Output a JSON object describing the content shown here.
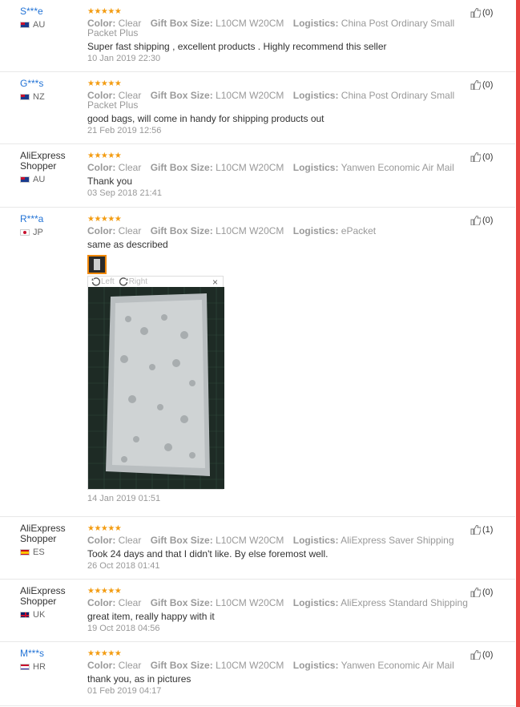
{
  "labels": {
    "color": "Color:",
    "gift_box_size": "Gift Box Size:",
    "logistics": "Logistics:"
  },
  "stars": "★★★★★",
  "viewer": {
    "left": "Left",
    "right": "Right",
    "close": "×"
  },
  "reviews": [
    {
      "user": "S***e",
      "country": "AU",
      "color": "Clear",
      "size": "L10CM W20CM",
      "logistics": "China Post Ordinary Small Packet Plus",
      "text": "Super fast shipping , excellent products . Highly recommend this seller",
      "date": "10 Jan 2019 22:30",
      "helpful": "(0)"
    },
    {
      "user": "G***s",
      "country": "NZ",
      "color": "Clear",
      "size": "L10CM W20CM",
      "logistics": "China Post Ordinary Small Packet Plus",
      "text": "good bags, will come in handy for shipping products out",
      "date": "21 Feb 2019 12:56",
      "helpful": "(0)"
    },
    {
      "user": "AliExpress Shopper",
      "country": "AU",
      "color": "Clear",
      "size": "L10CM W20CM",
      "logistics": "Yanwen Economic Air Mail",
      "text": "Thank you",
      "date": "03 Sep 2018 21:41",
      "helpful": "(0)"
    },
    {
      "user": "R***a",
      "country": "JP",
      "color": "Clear",
      "size": "L10CM W20CM",
      "logistics": "ePacket",
      "text": "same as described",
      "date": "14 Jan 2019 01:51",
      "helpful": "(0)"
    },
    {
      "user": "AliExpress Shopper",
      "country": "ES",
      "color": "Clear",
      "size": "L10CM W20CM",
      "logistics": "AliExpress Saver Shipping",
      "text": "Took 24 days and that I didn't like. By else foremost well.",
      "date": "26 Oct 2018 01:41",
      "helpful": "(1)"
    },
    {
      "user": "AliExpress Shopper",
      "country": "UK",
      "color": "Clear",
      "size": "L10CM W20CM",
      "logistics": "AliExpress Standard Shipping",
      "text": "great item, really happy with it",
      "date": "19 Oct 2018 04:56",
      "helpful": "(0)"
    },
    {
      "user": "M***s",
      "country": "HR",
      "color": "Clear",
      "size": "L10CM W20CM",
      "logistics": "Yanwen Economic Air Mail",
      "text": "thank you, as in pictures",
      "date": "01 Feb 2019 04:17",
      "helpful": "(0)"
    }
  ]
}
